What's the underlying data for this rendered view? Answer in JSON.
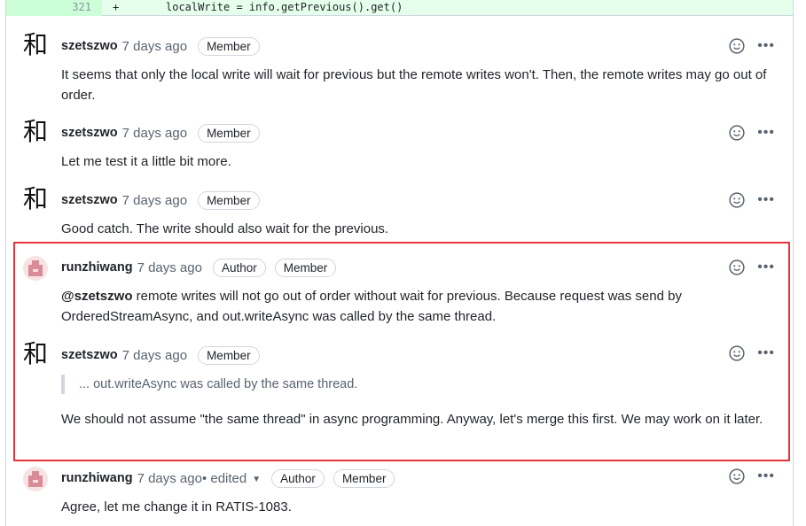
{
  "diff": {
    "line_number": "321",
    "sign": "+",
    "code": "localWrite = info.getPrevious().get()"
  },
  "comments": [
    {
      "author": "szetszwo",
      "time": "7 days ago",
      "badges": [
        "Member"
      ],
      "text": "It seems that only the local write will wait for previous but the remote writes won't. Then, the remote writes may go out of order."
    },
    {
      "author": "szetszwo",
      "time": "7 days ago",
      "badges": [
        "Member"
      ],
      "text": "Let me test it a little bit more."
    },
    {
      "author": "szetszwo",
      "time": "7 days ago",
      "badges": [
        "Member"
      ],
      "text": "Good catch. The write should also wait for the previous."
    },
    {
      "author": "runzhiwang",
      "time": "7 days ago",
      "badges": [
        "Author",
        "Member"
      ],
      "mention": "@szetszwo",
      "text": " remote writes will not go out of order without wait for previous. Because request was send by OrderedStreamAsync, and out.writeAsync was called by the same thread."
    },
    {
      "author": "szetszwo",
      "time": "7 days ago",
      "badges": [
        "Member"
      ],
      "quote": "... out.writeAsync was called by the same thread.",
      "text": "We should not assume \"the same thread\" in async programming. Anyway, let's merge this first. We may work on it later."
    },
    {
      "author": "runzhiwang",
      "time": "7 days ago",
      "edited": " • edited",
      "badges": [
        "Author",
        "Member"
      ],
      "text": "Agree, let me change it in RATIS-1083."
    }
  ],
  "avatar_glyph": "和",
  "icons": {
    "reaction": "smiley-icon",
    "more": "kebab-horizontal-icon",
    "more_glyph": "•••"
  },
  "colors": {
    "highlight": "#e5353b",
    "diff_added_bg": "#e6ffec",
    "badge_border": "#d0d7de"
  }
}
